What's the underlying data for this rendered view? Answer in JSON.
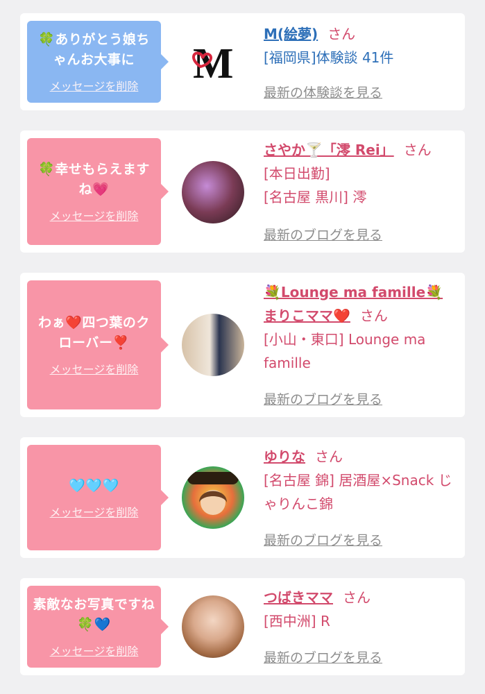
{
  "delete_label": "メッセージを削除",
  "suffix_san": "さん",
  "colors": {
    "blue_bubble": "#8ab7f2",
    "pink_bubble": "#f895a7",
    "name_pink": "#d24a6c",
    "name_blue": "#2d6fb8"
  },
  "cards": [
    {
      "message": "🍀ありがとう娘ちゃんお大事に",
      "name": "M(絵夢)",
      "lines": [
        "[福岡県]体験談 41件"
      ],
      "more": "最新の体験談を見る"
    },
    {
      "message": "🍀幸せもらえますね💗",
      "name": "さやか🍸「澪 Rei」",
      "lines": [
        "[本日出勤]",
        "[名古屋 黒川] 澪"
      ],
      "more": "最新のブログを見る"
    },
    {
      "message": "わぁ❤️四つ葉のクローバー❣️",
      "name": "💐Lounge ma famille💐",
      "name2": "まりこママ❤️",
      "lines": [
        "[小山・東口] Lounge ma famille"
      ],
      "more": "最新のブログを見る"
    },
    {
      "message": "🩵🩵🩵",
      "name": "ゆりな",
      "lines": [
        "[名古屋 錦] 居酒屋×Snack じゃりんこ錦"
      ],
      "more": "最新のブログを見る"
    },
    {
      "message": "素敵なお写真ですね🍀💙",
      "name": "つばきママ",
      "lines": [
        "[西中洲] R"
      ],
      "more": "最新のブログを見る"
    }
  ]
}
